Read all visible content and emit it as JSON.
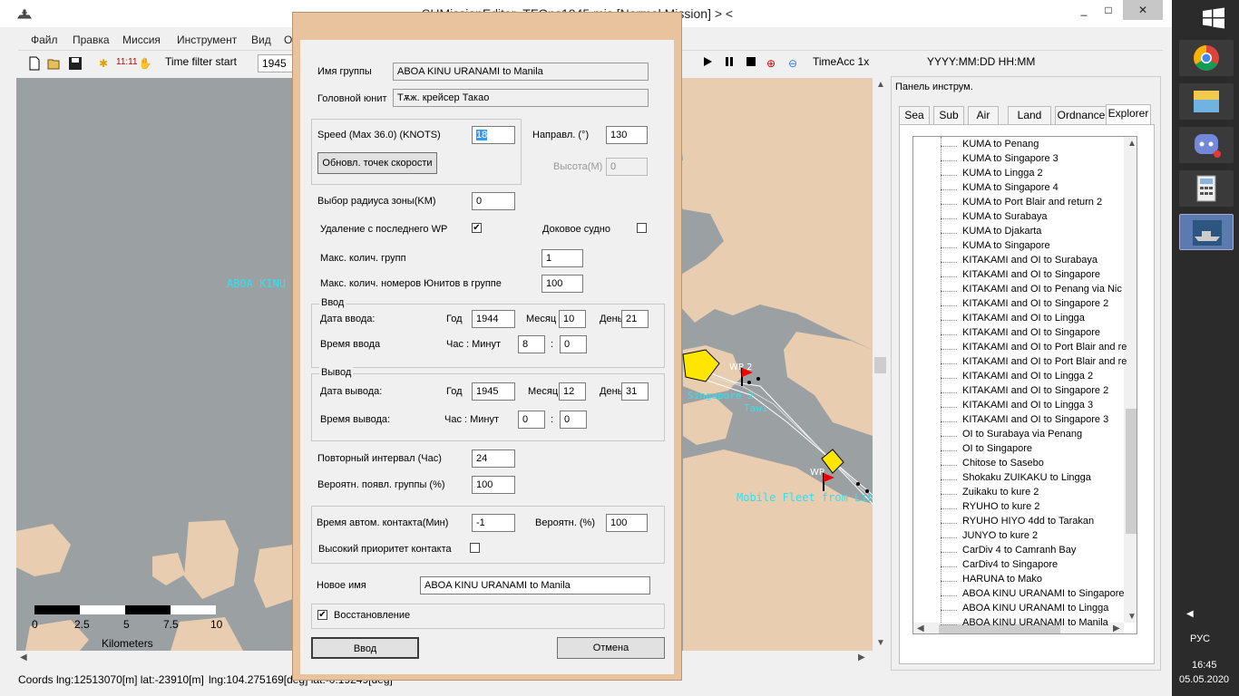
{
  "window": {
    "title": "SHMissionEditor_TFOps1945.mis [Normal Mission]   > <",
    "btn_min": "_",
    "btn_max": "□",
    "btn_close": "✕"
  },
  "menu": [
    "Файл",
    "Правка",
    "Миссия",
    "Инструмент",
    "Вид",
    "О"
  ],
  "toolbar": {
    "time_filter_label": "Time filter start",
    "year_value": "1945",
    "clock_label": "11:11",
    "time_acc": "TimeAcc 1x",
    "date_format": "YYYY:MM:DD HH:MM"
  },
  "map": {
    "group_label": "ABOA KINU U",
    "wp2": "WP 2",
    "wp_partial": "WP",
    "fleet_label": "Mobile Fleet from Lingga",
    "tawi_label": "Tawi",
    "garbled_label": "Singapore 2",
    "scale_ticks": [
      "0",
      "2.5",
      "5",
      "7.5",
      "10"
    ],
    "scale_unit": "Kilometers",
    "colors": {
      "sea": "#9ba1a3",
      "land": "#e8cdb0",
      "label": "#33e0f0"
    }
  },
  "status": {
    "coords": "Coords lng:12513070[m] lat:-23910[m]",
    "lnglat": "lng:104.275169[deg] lat:-0.19249[deg]"
  },
  "tool_panel": {
    "title": "Панель инструм.",
    "tabs": [
      "Sea",
      "Sub",
      "Air",
      "Land",
      "Ordnance",
      "Explorer"
    ],
    "active_tab": "Explorer",
    "items": [
      "KUMA to Penang",
      "KUMA to Singapore 3",
      "KUMA to Lingga 2",
      "KUMA to Singapore 4",
      "KUMA to Port Blair and return 2",
      "KUMA to Surabaya",
      "KUMA to Djakarta",
      "KUMA to  Singapore",
      "KITAKAMI and  OI to Surabaya",
      "KITAKAMI and OI to Singapore",
      "KITAKAMI and  OI to Penang via Nic",
      "KITAKAMI and OI to Singapore 2",
      "KITAKAMI and  OI to Lingga",
      "KITAKAMI and  OI to Singapore",
      "KITAKAMI and  OI to Port Blair and re",
      "KITAKAMI and  OI to Port Blair and re",
      "KITAKAMI and  OI to Lingga 2",
      "KITAKAMI and  OI to Singapore 2",
      "KITAKAMI and  OI to Lingga 3",
      "KITAKAMI and  OI to Singapore 3",
      "OI to Surabaya via Penang",
      "OI to Singapore",
      "Chitose to Sasebo",
      "Shokaku ZUIKAKU to Lingga",
      "Zuikaku to kure 2",
      "RYUHO to kure 2",
      "RYUHO  HIYO 4dd to Tarakan",
      "JUNYO to kure 2",
      "CarDiv 4 to Camranh Bay",
      "CarDiv4 to Singapore",
      "HARUNA to Mako",
      "ABOA KINU URANAMI to Singapore",
      "ABOA KINU URANAMI to Lingga",
      "ABOA KINU URANAMI to Manila"
    ]
  },
  "dialog": {
    "group_name_label": "Имя группы",
    "group_name_value": "ABOA KINU URANAMI to Manila",
    "lead_unit_label": "Головной юнит",
    "lead_unit_value": "Тѫж. крейсер Такао",
    "speed_label": "Speed (Max 36.0) (KNOTS)",
    "speed_value": "18",
    "heading_label": "Направл. (°)",
    "heading_value": "130",
    "update_speed_button": "Обновл. точек скорости",
    "altitude_label": "Высота(М)",
    "altitude_value": "0",
    "zone_radius_label": "Выбор радиуса зоны(KM)",
    "zone_radius_value": "0",
    "delete_last_wp_label": "Удаление с последнего WP",
    "delete_last_wp_checked": true,
    "dock_ship_label": "Доковое судно",
    "dock_ship_checked": false,
    "max_groups_label": "Макс. колич. групп",
    "max_groups_value": "1",
    "max_units_label": "Макс. колич. номеров Юнитов в группе",
    "max_units_value": "100",
    "entry_group": "Ввод",
    "entry_date_label": "Дата ввода:",
    "year_label": "Год",
    "month_label": "Месяц",
    "day_label": "День",
    "entry_year": "1944",
    "entry_month": "10",
    "entry_day": "21",
    "entry_time_label": "Время ввода",
    "hour_min_label": "Час : Минут",
    "entry_hour": "8",
    "entry_min": "0",
    "colon": ":",
    "exit_group": "Вывод",
    "exit_date_label": "Дата вывода:",
    "exit_year": "1945",
    "exit_month": "12",
    "exit_day": "31",
    "exit_time_label": "Время вывода:",
    "exit_hour": "0",
    "exit_min": "0",
    "repeat_label": "Повторный интервал (Час)",
    "repeat_value": "24",
    "probability_label": "Вероятн. появл. группы (%)",
    "probability_value": "100",
    "auto_contact_label": "Время автом. контакта(Мин)",
    "auto_contact_value": "-1",
    "auto_prob_label": "Вероятн. (%)",
    "auto_prob_value": "100",
    "high_priority_label": "Высокий приоритет контакта",
    "high_priority_checked": false,
    "new_name_label": "Новое имя",
    "new_name_value": "ABOA KINU URANAMI to Manila",
    "restore_label": "Восстановление",
    "restore_checked": true,
    "ok_button": "Ввод",
    "cancel_button": "Отмена"
  },
  "taskbar": {
    "lang": "РУС",
    "time": "16:45",
    "date": "05.05.2020"
  }
}
